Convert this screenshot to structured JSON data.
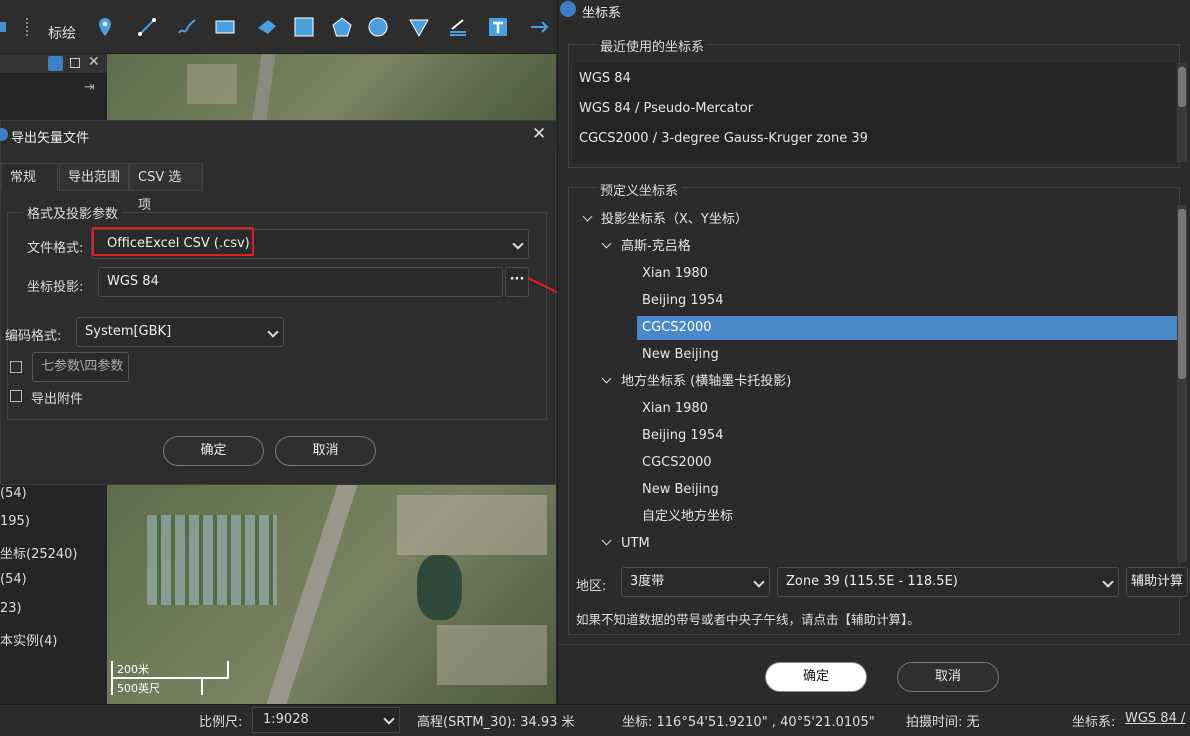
{
  "toolbar": {
    "label": "标绘"
  },
  "left_panel": {
    "items": [
      "(54)",
      "195)",
      "坐标(25240)",
      "(54)",
      "23)",
      "本实例(4)"
    ]
  },
  "export_dialog": {
    "title": "导出矢量文件",
    "tabs": [
      "常规",
      "导出范围",
      "CSV 选项"
    ],
    "group_title": "格式及投影参数",
    "file_format_label": "文件格式:",
    "file_format_value": "OfficeExcel CSV (.csv)",
    "projection_label": "坐标投影:",
    "projection_value": "WGS 84",
    "projection_button": "···",
    "encoding_label": "编码格式:",
    "encoding_value": "System[GBK]",
    "seven_params": "七参数\\四参数",
    "export_attachments": "导出附件",
    "ok": "确定",
    "cancel": "取消"
  },
  "map": {
    "scale_200": "200米",
    "scale_500": "500英尺"
  },
  "crs_dialog": {
    "title": "坐标系",
    "recent_title": "最近使用的坐标系",
    "recent": [
      "WGS 84",
      "WGS 84 / Pseudo-Mercator",
      "CGCS2000 / 3-degree Gauss-Kruger zone 39"
    ],
    "predefined_title": "预定义坐标系",
    "tree": {
      "projected": "投影坐标系（X、Y坐标）",
      "gauss": "高斯-克吕格",
      "gauss_items": [
        "Xian 1980",
        "Beijing 1954",
        "CGCS2000",
        "New Beijing"
      ],
      "local": "地方坐标系 (横轴墨卡托投影)",
      "local_items": [
        "Xian 1980",
        "Beijing 1954",
        "CGCS2000",
        "New Beijing",
        "自定义地方坐标"
      ],
      "utm": "UTM"
    },
    "region_label": "地区:",
    "band_value": "3度带",
    "zone_value": "Zone 39 (115.5E - 118.5E)",
    "assist_button": "辅助计算",
    "hint": "如果不知道数据的带号或者中央子午线，请点击【辅助计算】。",
    "ok": "确定",
    "cancel": "取消"
  },
  "status_bar": {
    "scale_label": "比例尺:",
    "scale_value": "1:9028",
    "elevation": "高程(SRTM_30): 34.93 米",
    "coords": "坐标:  116°54'51.9210\" , 40°5'21.0105\"",
    "capture_time": "拍摄时间:  无",
    "crs_label": "坐标系:",
    "crs_value": "WGS 84 /"
  },
  "colors": {
    "accent": "#4a8fd6",
    "highlight": "#e02020",
    "selection": "#4a88c7"
  }
}
